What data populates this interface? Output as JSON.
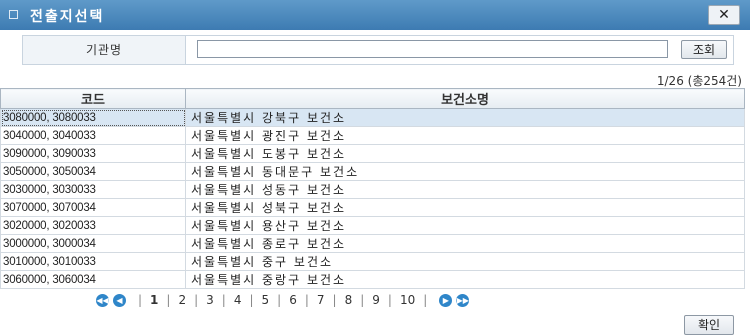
{
  "window": {
    "title": "전출지선택",
    "close_label": "✕"
  },
  "search": {
    "label": "기관명",
    "value": "",
    "button_label": "조회"
  },
  "page_info": "1/26 (총254건)",
  "table": {
    "columns": [
      "코드",
      "보건소명"
    ],
    "selected_row": 0,
    "rows": [
      {
        "code": "3080000, 3080033",
        "name": "서울특별시 강북구 보건소"
      },
      {
        "code": "3040000, 3040033",
        "name": "서울특별시 광진구 보건소"
      },
      {
        "code": "3090000, 3090033",
        "name": "서울특별시 도봉구 보건소"
      },
      {
        "code": "3050000, 3050034",
        "name": "서울특별시 동대문구 보건소"
      },
      {
        "code": "3030000, 3030033",
        "name": "서울특별시 성동구 보건소"
      },
      {
        "code": "3070000, 3070034",
        "name": "서울특별시 성북구 보건소"
      },
      {
        "code": "3020000, 3020033",
        "name": "서울특별시 용산구 보건소"
      },
      {
        "code": "3000000, 3000034",
        "name": "서울특별시 종로구 보건소"
      },
      {
        "code": "3010000, 3010033",
        "name": "서울특별시 중구 보건소"
      },
      {
        "code": "3060000, 3060034",
        "name": "서울특별시 중랑구 보건소"
      }
    ]
  },
  "pager": {
    "pages": [
      "1",
      "2",
      "3",
      "4",
      "5",
      "6",
      "7",
      "8",
      "9",
      "10"
    ],
    "current": "1",
    "icons": [
      "first-page-icon",
      "prev-page-icon",
      "next-page-icon",
      "last-page-icon"
    ]
  },
  "footer": {
    "confirm_label": "확인"
  },
  "colors": {
    "titlebar": "#3d7bb2",
    "selected_row": "#d8e6f3",
    "pager_icon": "#2f86c9"
  }
}
